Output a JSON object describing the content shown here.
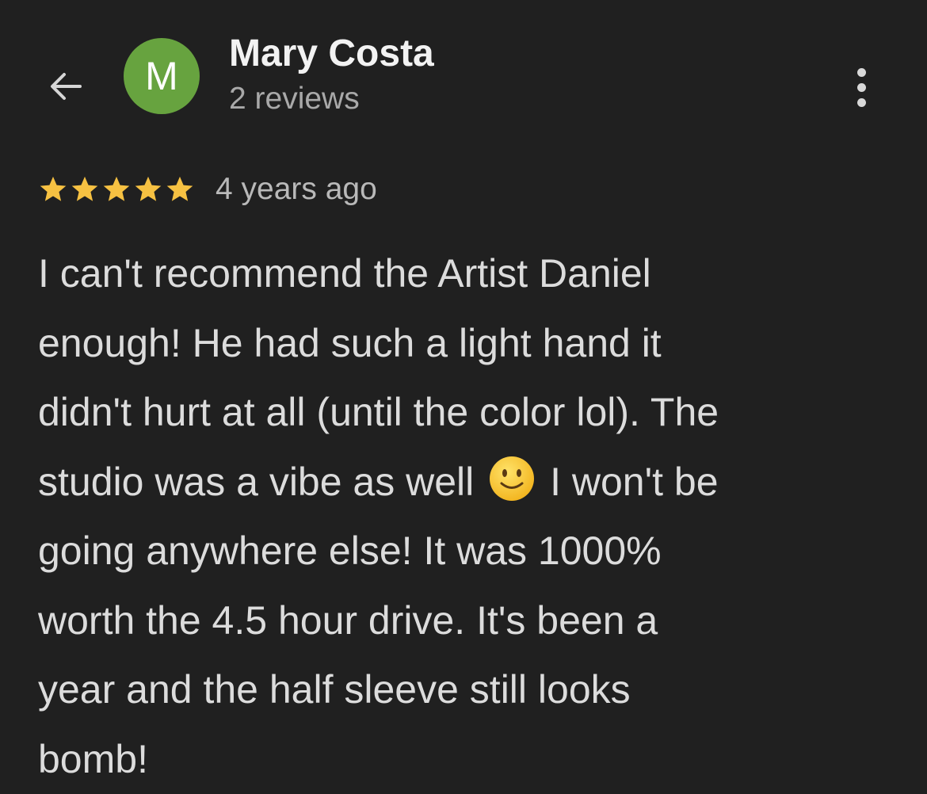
{
  "header": {
    "avatar_letter": "M",
    "author_name": "Mary Costa",
    "review_count": "2 reviews",
    "avatar_color": "#67a33f"
  },
  "review": {
    "rating": 5,
    "rating_max": 5,
    "time": "4 years ago",
    "lines": [
      "I can't recommend the Artist Daniel",
      "enough! He had such a light hand it",
      "didn't hurt at all (until the color lol). The",
      "studio was a vibe as well",
      "I won't be",
      "going anywhere else! It was 1000%",
      "worth the 4.5 hour drive. It's been a",
      "year and the half sleeve still looks",
      "bomb!"
    ],
    "star_color": "#f6c142"
  },
  "icons": {
    "back": "arrow-left-icon",
    "more": "more-vertical-icon",
    "emoji": "slightly-smiling-face-emoji"
  }
}
